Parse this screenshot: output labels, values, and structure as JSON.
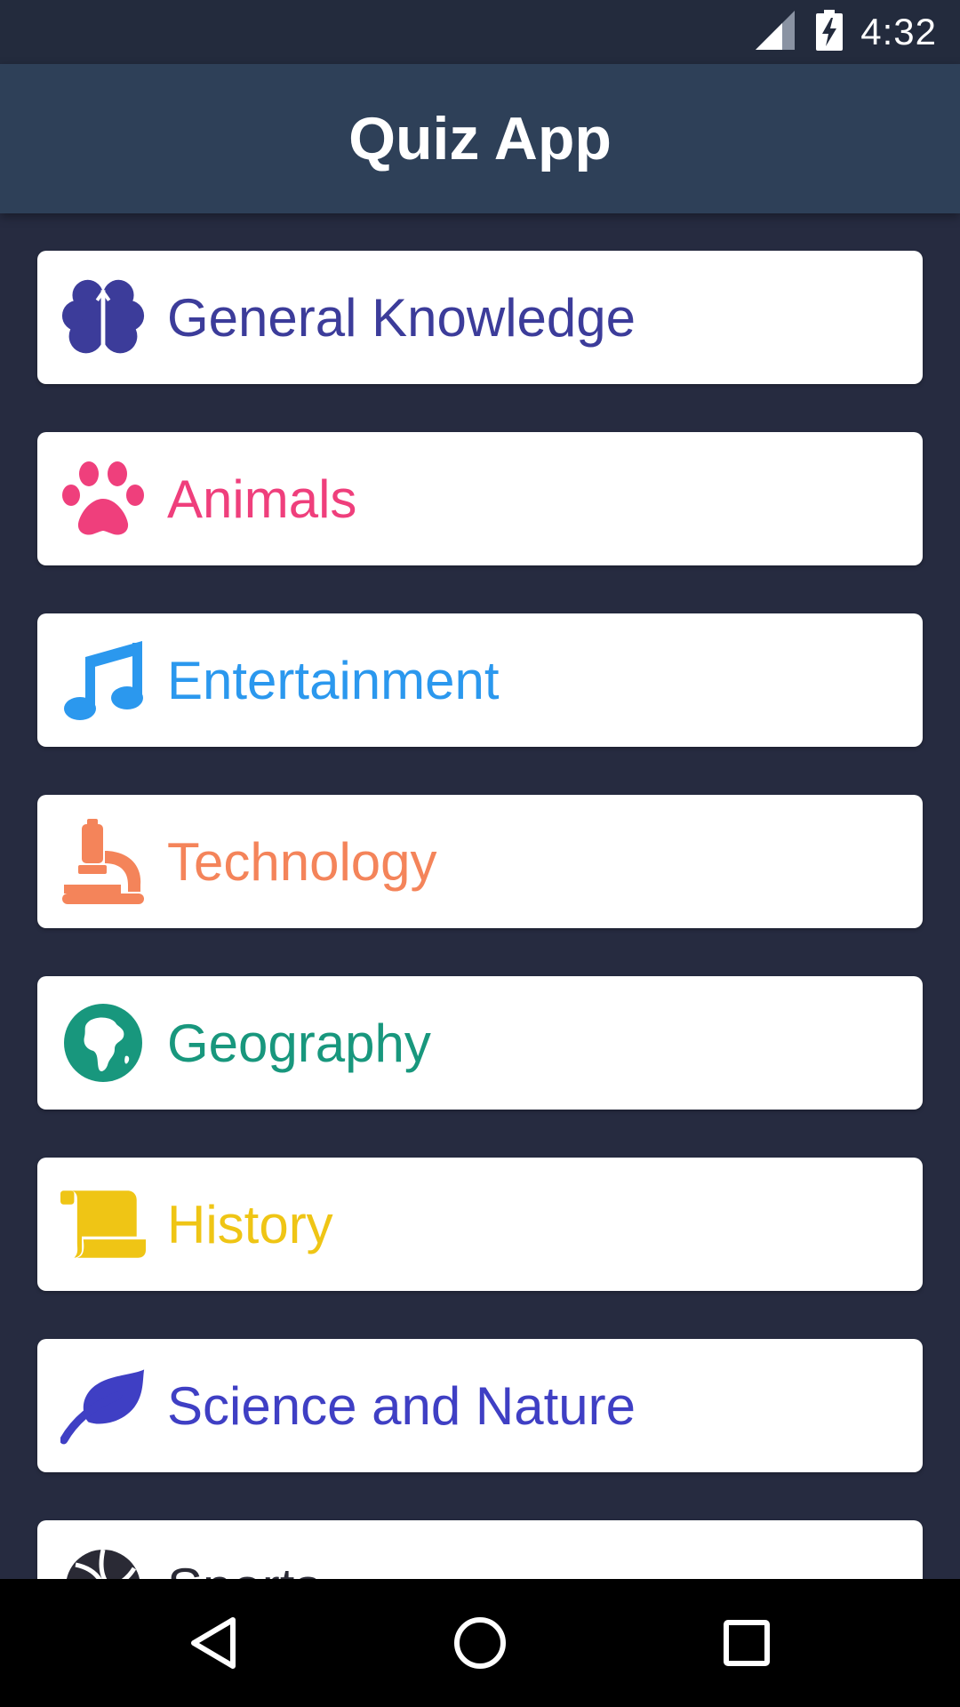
{
  "status_bar": {
    "time": "4:32"
  },
  "app_bar": {
    "title": "Quiz App"
  },
  "categories": [
    {
      "label": "General Knowledge",
      "icon": "brain-icon",
      "color": "#3c3c9a"
    },
    {
      "label": "Animals",
      "icon": "paw-icon",
      "color": "#ef3f7c"
    },
    {
      "label": "Entertainment",
      "icon": "music-note-icon",
      "color": "#2b98ee"
    },
    {
      "label": "Technology",
      "icon": "microscope-icon",
      "color": "#f4845a"
    },
    {
      "label": "Geography",
      "icon": "globe-africa-icon",
      "color": "#18977d"
    },
    {
      "label": "History",
      "icon": "scroll-icon",
      "color": "#efc515"
    },
    {
      "label": "Science and Nature",
      "icon": "leaf-icon",
      "color": "#3f3fc4"
    },
    {
      "label": "Sports",
      "icon": "volleyball-icon",
      "color": "#2a2a35"
    }
  ],
  "navigation": {
    "back": "back-icon",
    "home": "home-icon",
    "recents": "recents-icon"
  }
}
